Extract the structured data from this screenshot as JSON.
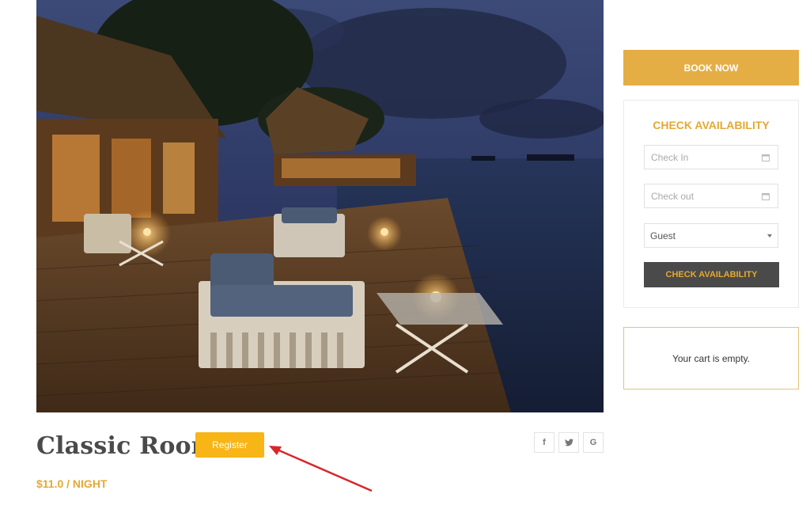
{
  "room": {
    "title": "Classic Room",
    "price": "$11.0 / NIGHT",
    "register_label": "Register"
  },
  "share": {
    "items": [
      {
        "icon": "facebook-icon",
        "glyph": "f"
      },
      {
        "icon": "twitter-icon",
        "glyph": "🐦"
      },
      {
        "icon": "google-icon",
        "glyph": "G"
      }
    ]
  },
  "sidebar": {
    "book_now_label": "BOOK NOW",
    "availability": {
      "title": "CHECK AVAILABILITY",
      "check_in_placeholder": "Check In",
      "check_out_placeholder": "Check out",
      "guest_value": "Guest",
      "button_label": "CHECK AVAILABILITY"
    },
    "cart": {
      "empty_text": "Your cart is empty."
    }
  },
  "colors": {
    "accent": "#e4ae45",
    "register": "#f7b516",
    "dark_button": "#4a4a4a",
    "annotation_arrow": "#d9262b"
  }
}
